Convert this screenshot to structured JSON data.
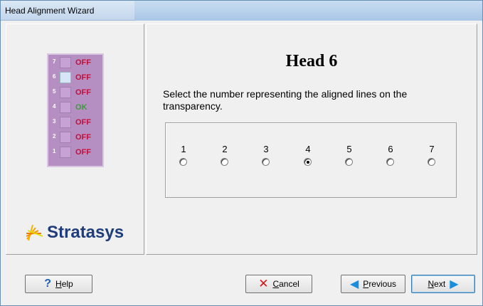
{
  "window": {
    "title": "Head Alignment Wizard"
  },
  "head_status_panel": {
    "heads": [
      {
        "num": "7",
        "status": "OFF",
        "selected": false
      },
      {
        "num": "6",
        "status": "OFF",
        "selected": true
      },
      {
        "num": "5",
        "status": "OFF",
        "selected": false
      },
      {
        "num": "4",
        "status": "OK",
        "selected": false
      },
      {
        "num": "3",
        "status": "OFF",
        "selected": false
      },
      {
        "num": "2",
        "status": "OFF",
        "selected": false
      },
      {
        "num": "1",
        "status": "OFF",
        "selected": false
      }
    ]
  },
  "branding": {
    "logo_text": "Stratasys"
  },
  "main": {
    "title": "Head 6",
    "instruction": "Select the number representing the aligned lines on the transparency.",
    "options": [
      "1",
      "2",
      "3",
      "4",
      "5",
      "6",
      "7"
    ],
    "selected_option": "4"
  },
  "buttons": {
    "help": "Help",
    "cancel": "Cancel",
    "previous": "Previous",
    "next": "Next"
  },
  "colors": {
    "off": "#c0103b",
    "ok": "#3c9b3c",
    "panel": "#b68fc2",
    "logo": "#1f3d7a"
  }
}
